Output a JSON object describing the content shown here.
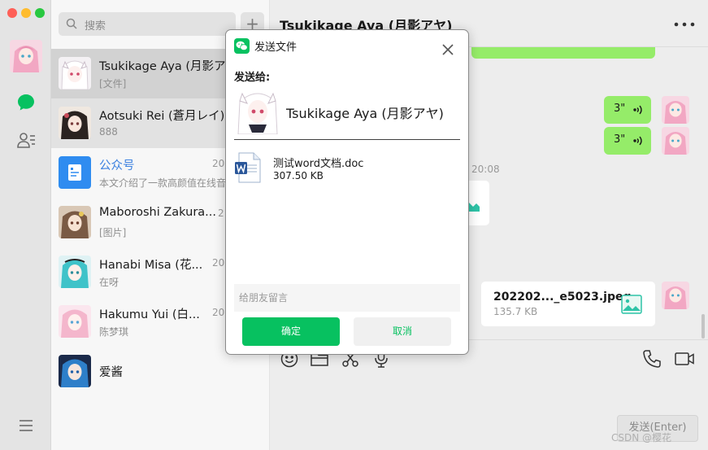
{
  "colors": {
    "accent_green": "#07c160",
    "bubble_green": "#95ec69",
    "link_blue": "#3d82e0",
    "traffic_red": "#fe5f57",
    "traffic_yellow": "#febc2e",
    "traffic_green": "#28c840"
  },
  "rail": {
    "icons": [
      "chat-icon",
      "contacts-icon",
      "menu-icon"
    ]
  },
  "search": {
    "placeholder": "搜索"
  },
  "conversations": [
    {
      "name": "Tsukikage Aya (月影アヤ)",
      "preview": "[文件]",
      "time": ""
    },
    {
      "name": "Aotsuki Rei (蒼月レイ)",
      "preview": "888",
      "time": ""
    },
    {
      "name": "公众号",
      "preview": "本文介绍了一款高颜值在线音",
      "time": "20"
    },
    {
      "name": "Maboroshi Zakura...",
      "preview": "[图片]",
      "time": "2"
    },
    {
      "name": "Hanabi Misa (花...",
      "preview": "在呀",
      "time": "20"
    },
    {
      "name": "Hakumu Yui (白...",
      "preview": "陈梦琪",
      "time": "20"
    },
    {
      "name": "爱酱",
      "preview": "",
      "time": ""
    }
  ],
  "chat": {
    "title": "Tsukikage Aya (月影アヤ)",
    "messages": [
      {
        "type": "voice",
        "duration": "3\""
      },
      {
        "type": "voice",
        "duration": "3\""
      }
    ],
    "time_label": "20:08",
    "file": {
      "name": "202202..._e5023.jpeg",
      "size": "135.7 KB"
    },
    "toolbar_icons": [
      "emoji-icon",
      "folder-icon",
      "scissors-icon",
      "microphone-icon",
      "phone-icon",
      "video-icon"
    ],
    "send_label": "发送(Enter)"
  },
  "watermark": "CSDN @樱花",
  "dialog": {
    "title": "发送文件",
    "send_to_label": "发送给:",
    "recipient": "Tsukikage Aya (月影アヤ)",
    "file_name": "测试word文档.doc",
    "file_size": "307.50 KB",
    "message_placeholder": "给朋友留言",
    "confirm_label": "确定",
    "cancel_label": "取消"
  }
}
